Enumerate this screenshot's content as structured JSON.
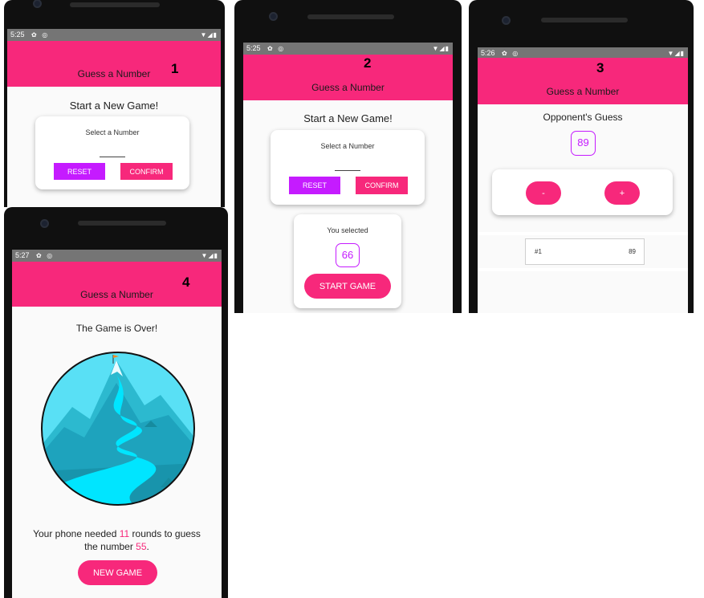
{
  "app_title": "Guess a Number",
  "screens": [
    {
      "label": "1",
      "time": "5:25",
      "headline": "Start a New Game!",
      "select_caption": "Select a Number",
      "reset_label": "RESET",
      "confirm_label": "CONFIRM"
    },
    {
      "label": "2",
      "time": "5:25",
      "headline": "Start a New Game!",
      "select_caption": "Select a Number",
      "reset_label": "RESET",
      "confirm_label": "CONFIRM",
      "selected_caption": "You selected",
      "selected_number": "66",
      "start_label": "START GAME"
    },
    {
      "label": "3",
      "time": "5:26",
      "headline": "Opponent's Guess",
      "guess_number": "89",
      "minus_label": "-",
      "plus_label": "+",
      "log_round": "#1",
      "log_value": "89"
    },
    {
      "label": "4",
      "time": "5:27",
      "headline": "The Game is Over!",
      "summary_part1": "Your phone needed ",
      "rounds": "11",
      "summary_part2": " rounds to guess",
      "summary_part3": "the number ",
      "number": "55",
      "summary_part4": ".",
      "new_game_label": "NEW GAME"
    }
  ],
  "icons": {
    "settings": "gear-icon",
    "sync": "sync-icon",
    "wifi": "wifi-icon",
    "signal": "signal-icon",
    "battery": "battery-icon"
  },
  "colors": {
    "accent": "#f7287b",
    "secondary": "#c51bff",
    "status_bar": "#757575"
  }
}
